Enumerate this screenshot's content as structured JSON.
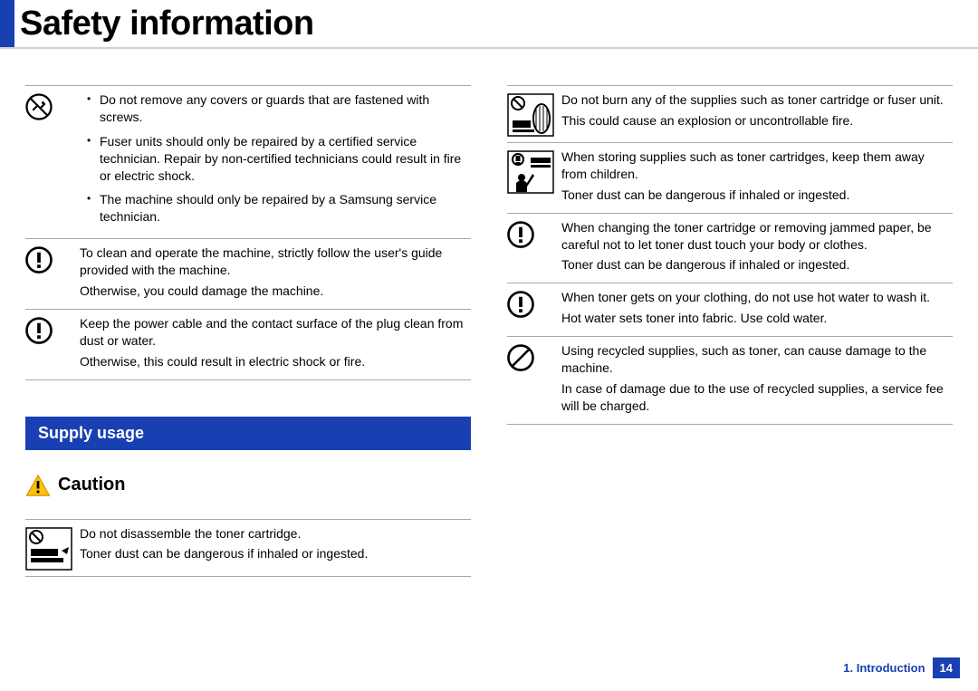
{
  "title": "Safety information",
  "section_heading": "Supply usage",
  "caution_label": "Caution",
  "footer": {
    "chapter": "1. Introduction",
    "page": "14"
  },
  "left": {
    "r1": {
      "b1": "Do not remove any covers or guards that are fastened with screws.",
      "b2": "Fuser units should only be repaired by a certified service technician. Repair by non-certified technicians could result in fire or electric shock.",
      "b3": "The machine should only be repaired by a Samsung service technician."
    },
    "r2": {
      "p1": "To clean and operate the machine, strictly follow the user's guide provided with the machine.",
      "p2": "Otherwise, you could damage the machine."
    },
    "r3": {
      "p1": "Keep the power cable and the contact surface of the plug clean from dust or water.",
      "p2": "Otherwise, this could result in electric shock or fire."
    },
    "r4": {
      "p1": "Do not disassemble the toner cartridge.",
      "p2": "Toner dust can be dangerous if inhaled or ingested."
    }
  },
  "right": {
    "r1": {
      "p1": "Do not burn any of the supplies such as toner cartridge or fuser unit.",
      "p2": "This could cause an explosion or uncontrollable fire."
    },
    "r2": {
      "p1": "When storing supplies such as toner cartridges, keep them away from children.",
      "p2": "Toner dust can be dangerous if inhaled or ingested."
    },
    "r3": {
      "p1": "When changing the toner cartridge or removing jammed paper, be careful not to let toner dust touch your body or clothes.",
      "p2": "Toner dust can be dangerous if inhaled or ingested."
    },
    "r4": {
      "p1": "When toner gets on your clothing, do not use hot water to wash it.",
      "p2": "Hot water sets toner into fabric. Use cold water."
    },
    "r5": {
      "p1": "Using recycled supplies, such as toner, can cause damage to the machine.",
      "p2": "In case of damage due to the use of recycled supplies, a service fee will be charged."
    }
  }
}
